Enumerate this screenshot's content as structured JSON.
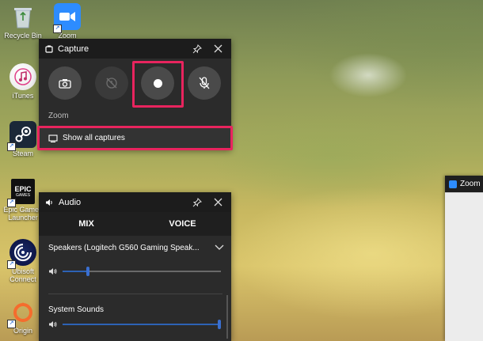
{
  "desktop": {
    "icons": [
      {
        "label": "Recycle Bin",
        "icon": "recycle-bin-icon"
      },
      {
        "label": "Zoom",
        "icon": "zoom-app-icon"
      },
      {
        "label": "iTunes",
        "icon": "itunes-icon"
      },
      {
        "label": "Steam",
        "icon": "steam-icon"
      },
      {
        "label": "Epic Games Launcher",
        "icon": "epic-games-icon",
        "logo_text": "EPIC GAMES"
      },
      {
        "label": "Ubisoft Connect",
        "icon": "ubisoft-icon"
      },
      {
        "label": "Origin",
        "icon": "origin-icon"
      }
    ]
  },
  "capture": {
    "title": "Capture",
    "buttons": [
      {
        "name": "screenshot",
        "icon": "camera-icon"
      },
      {
        "name": "record-last-30s",
        "icon": "record-last-icon",
        "enabled": false
      },
      {
        "name": "start-recording",
        "icon": "record-dot-icon"
      },
      {
        "name": "microphone",
        "icon": "mic-off-icon"
      }
    ],
    "source_label": "Zoom",
    "show_all_label": "Show all captures",
    "highlight_color": "#e8245e"
  },
  "audio": {
    "title": "Audio",
    "tabs": [
      "MIX",
      "VOICE"
    ],
    "active_tab": "MIX",
    "device": "Speakers (Logitech G560 Gaming Speak...",
    "device_volume": 0.15,
    "system_sounds_label": "System Sounds",
    "system_sounds_volume": 1.0
  },
  "zoom_window": {
    "title": "Zoom"
  }
}
